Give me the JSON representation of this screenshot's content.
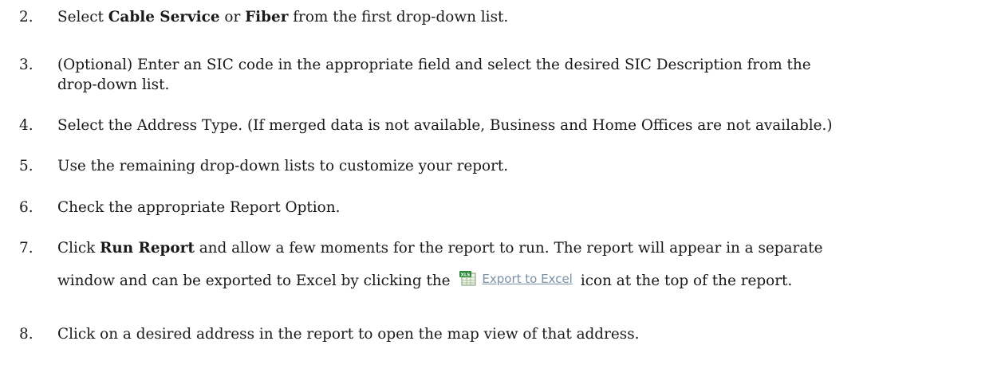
{
  "steps": [
    {
      "num": "2.",
      "pre1": "Select ",
      "bold1": "Cable Service",
      "mid1": " or ",
      "bold2": "Fiber",
      "post": " from the first drop-down list."
    },
    {
      "num": "3.",
      "line1": "(Optional) Enter an SIC code in the appropriate field and select the desired SIC Description from the",
      "line2": "drop-down list."
    },
    {
      "num": "4.",
      "text": "Select the Address Type. (If merged data is not available, Business and Home Offices are not available.)"
    },
    {
      "num": "5.",
      "text": "Use the remaining drop-down lists to customize your report."
    },
    {
      "num": "6.",
      "text": "Check the appropriate Report Option."
    },
    {
      "num": "7.",
      "pre": "Click ",
      "bold": "Run Report",
      "line1_post": " and allow a few moments for the report to run. The report will appear in a separate",
      "line2_pre": "window and can be exported to Excel by clicking the ",
      "icon": "excel-xls-icon",
      "link": "Export to Excel",
      "line2_post": "icon at the top of the report."
    },
    {
      "num": "8.",
      "text": "Click on a desired address in the report to open the map view of that address."
    }
  ]
}
